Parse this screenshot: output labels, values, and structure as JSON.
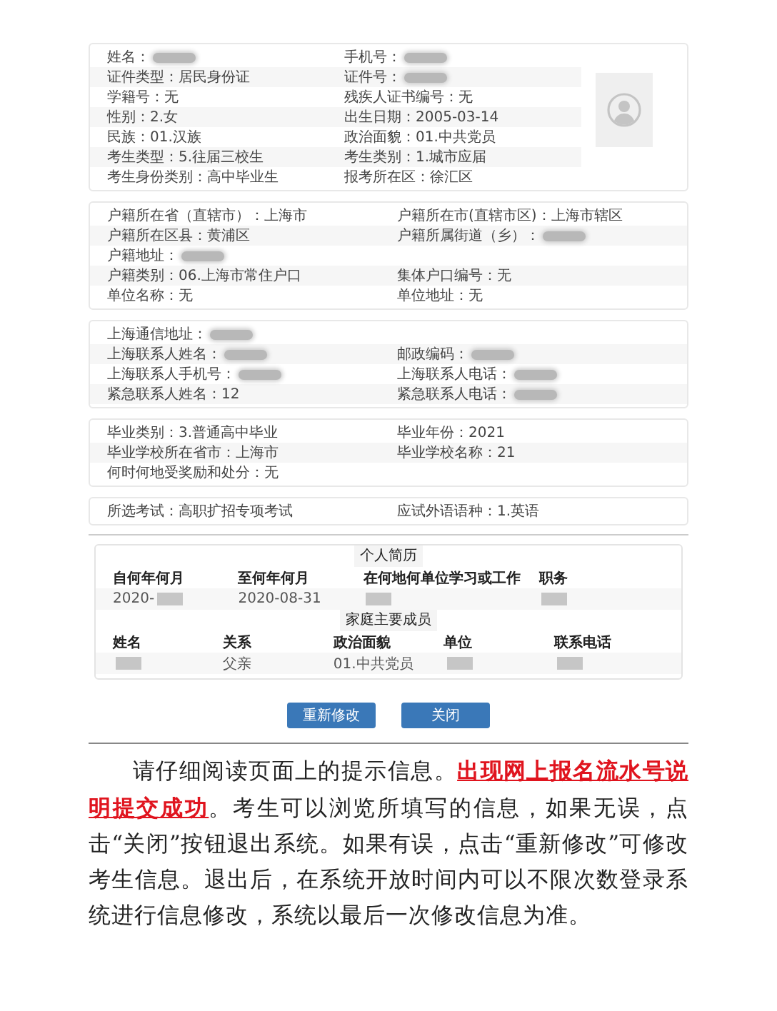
{
  "sections": [
    {
      "photo": {
        "kind": "placeholder"
      },
      "rows": [
        [
          {
            "label": "姓名：",
            "redacted": true
          },
          {
            "label": "手机号：",
            "redacted": true
          }
        ],
        [
          {
            "label": "证件类型：",
            "value": "居民身份证"
          },
          {
            "label": "证件号：",
            "redacted": true
          }
        ],
        [
          {
            "label": "学籍号：",
            "value": "无"
          },
          {
            "label": "残疾人证书编号：",
            "value": "无"
          }
        ],
        [
          {
            "label": "性别：",
            "value": "2.女"
          },
          {
            "label": "出生日期：",
            "value": "2005-03-14"
          }
        ],
        [
          {
            "label": "民族：",
            "value": "01.汉族"
          },
          {
            "label": "政治面貌：",
            "value": "01.中共党员"
          }
        ],
        [
          {
            "label": "考生类型：",
            "value": "5.往届三校生"
          },
          {
            "label": "考生类别：",
            "value": "1.城市应届"
          }
        ],
        [
          {
            "label": "考生身份类别：",
            "value": "高中毕业生"
          },
          {
            "label": "报考所在区：",
            "value": "徐汇区"
          }
        ]
      ]
    },
    {
      "rows": [
        [
          {
            "label": "户籍所在省（直辖市）：",
            "value": "上海市"
          },
          {
            "label": "户籍所在市(直辖市区)：",
            "value": "上海市辖区"
          }
        ],
        [
          {
            "label": "户籍所在区县：",
            "value": "黄浦区"
          },
          {
            "label": "户籍所属街道（乡）：",
            "redacted": true
          }
        ],
        [
          {
            "label": "户籍地址：",
            "redacted": true
          }
        ],
        [
          {
            "label": "户籍类别：",
            "value": "06.上海市常住户口"
          },
          {
            "label": "集体户口编号：",
            "value": "无"
          }
        ],
        [
          {
            "label": "单位名称：",
            "value": "无"
          },
          {
            "label": "单位地址：",
            "value": "无"
          }
        ]
      ]
    },
    {
      "rows": [
        [
          {
            "label": "上海通信地址：",
            "redacted": true
          }
        ],
        [
          {
            "label": "上海联系人姓名：",
            "redacted": true
          },
          {
            "label": "邮政编码：",
            "redacted": true
          }
        ],
        [
          {
            "label": "上海联系人手机号：",
            "redacted": true
          },
          {
            "label": "上海联系人电话：",
            "redacted": true
          }
        ],
        [
          {
            "label": "紧急联系人姓名：",
            "value": "12"
          },
          {
            "label": "紧急联系人电话：",
            "redacted": true
          }
        ]
      ]
    },
    {
      "rows": [
        [
          {
            "label": "毕业类别：",
            "value": "3.普通高中毕业"
          },
          {
            "label": "毕业年份：",
            "value": "2021"
          }
        ],
        [
          {
            "label": "毕业学校所在省市：",
            "value": "上海市"
          },
          {
            "label": "毕业学校名称：",
            "value": "21"
          }
        ],
        [
          {
            "label": "何时何地受奖励和处分：",
            "value": "无"
          }
        ]
      ]
    },
    {
      "rows": [
        [
          {
            "label": "所选考试：",
            "value": "高职扩招专项考试"
          },
          {
            "label": "应试外语语种：",
            "value": "1.英语"
          }
        ]
      ]
    }
  ],
  "resume": {
    "title": "个人简历",
    "columns": [
      "自何年何月",
      "至何年何月",
      "在何地何单位学习或工作",
      "职务"
    ],
    "rows": [
      [
        {
          "value": "2020-",
          "redacted": true
        },
        {
          "value": "2020-08-31"
        },
        {
          "redacted": true
        },
        {
          "redacted": true
        }
      ]
    ]
  },
  "family": {
    "title": "家庭主要成员",
    "columns": [
      "姓名",
      "关系",
      "政治面貌",
      "单位",
      "联系电话"
    ],
    "rows": [
      [
        {
          "redacted": true
        },
        {
          "value": "父亲"
        },
        {
          "value": "01.中共党员"
        },
        {
          "redacted": true
        },
        {
          "redacted": true
        }
      ]
    ]
  },
  "buttons": [
    "重新修改",
    "关闭"
  ],
  "paragraph": [
    {
      "text": "请仔细阅读页面上的提示信息。",
      "emphasis": false
    },
    {
      "text": "出现网上报名流水号说明提交成功",
      "emphasis": true
    },
    {
      "text": "。考生可以浏览所填写的信息，如果无误，点击“关闭”按钮退出系统。如果有误，点击“重新修改”可修改考生信息。退出后，在系统开放时间内可以不限次数登录系统进行信息修改，系统以最后一次修改信息为准。",
      "emphasis": false
    }
  ]
}
